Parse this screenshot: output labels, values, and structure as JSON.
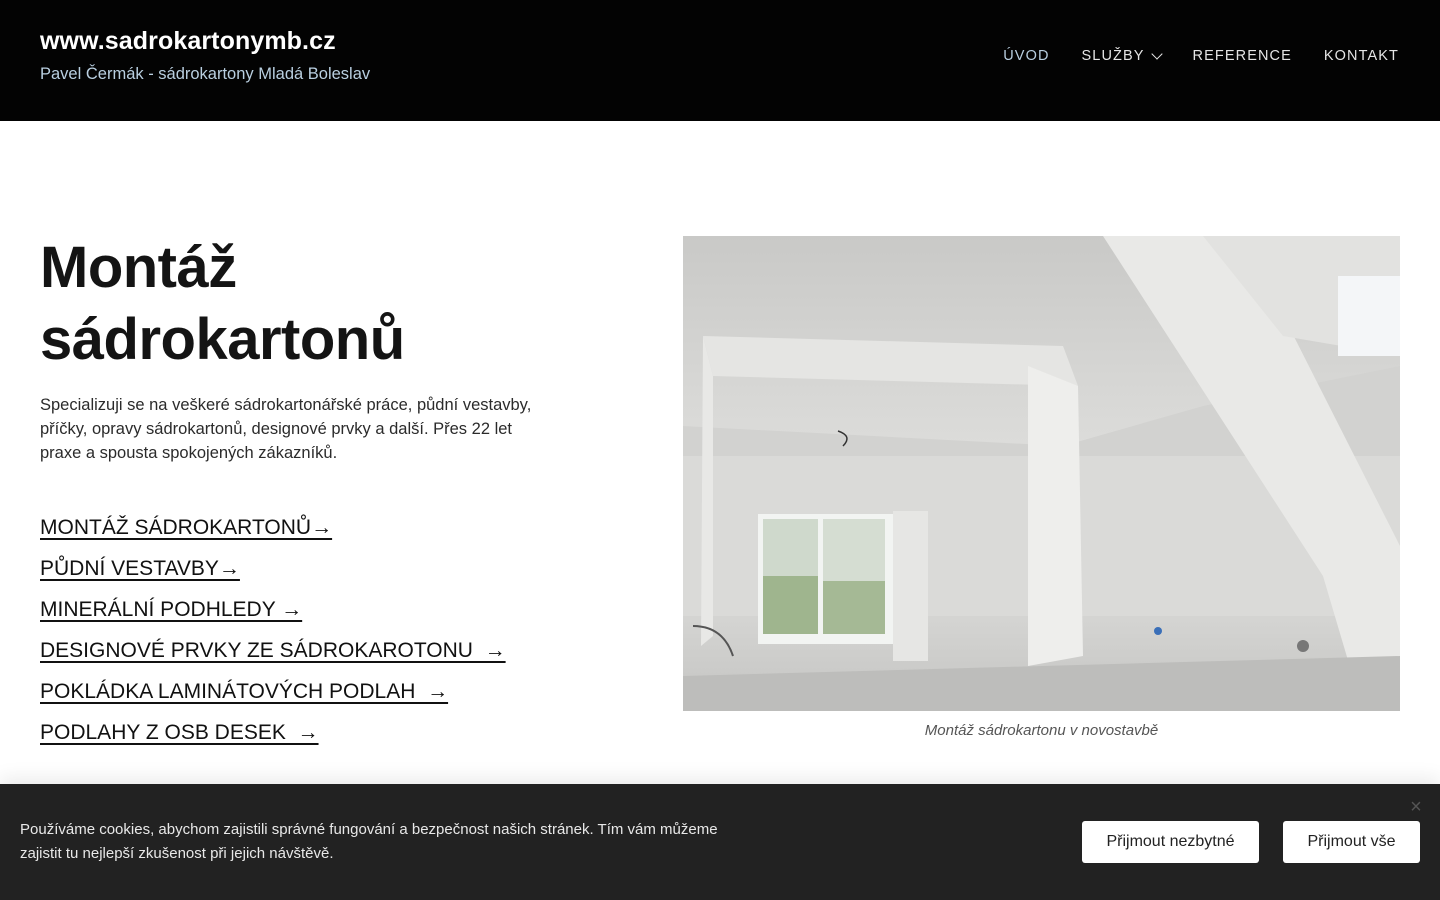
{
  "header": {
    "site_title": "www.sadrokartonymb.cz",
    "site_subtitle": "Pavel Čermák - sádrokartony Mladá Boleslav",
    "nav": [
      {
        "label": "ÚVOD",
        "active": true
      },
      {
        "label": "SLUŽBY",
        "has_dropdown": true
      },
      {
        "label": "REFERENCE"
      },
      {
        "label": "KONTAKT"
      }
    ]
  },
  "hero": {
    "title_line1": "Montáž",
    "title_line2": "sádrokartonů",
    "text": "Specializuji se na veškeré sádrokartonářské práce, půdní vestavby, příčky, opravy sádrokartonů, designové prvky a další. Přes 22 let praxe a spousta spokojených zákazníků.",
    "links": [
      "MONTÁŽ SÁDROKARTONŮ→",
      "PŮDNÍ VESTAVBY→",
      "MINERÁLNÍ PODHLEDY →",
      "DESIGNOVÉ PRVKY ZE SÁDROKAROTONU  →",
      "POKLÁDKA LAMINÁTOVÝCH PODLAH  →",
      "PODLAHY Z OSB DESEK  →"
    ]
  },
  "photo": {
    "caption": "Montáž sádrokartonu v novostavbě"
  },
  "cookie": {
    "text": "Používáme cookies, abychom zajistili správné fungování a bezpečnost našich stránek. Tím vám můžeme zajistit tu nejlepší zkušenost při jejich návštěvě.",
    "btn_necessary": "Přijmout nezbytné",
    "btn_all": "Přijmout vše",
    "close_icon": "close-icon"
  },
  "colors": {
    "header_bg": "#030303",
    "accent": "#b9cfe0",
    "cookie_bg": "#222222"
  }
}
